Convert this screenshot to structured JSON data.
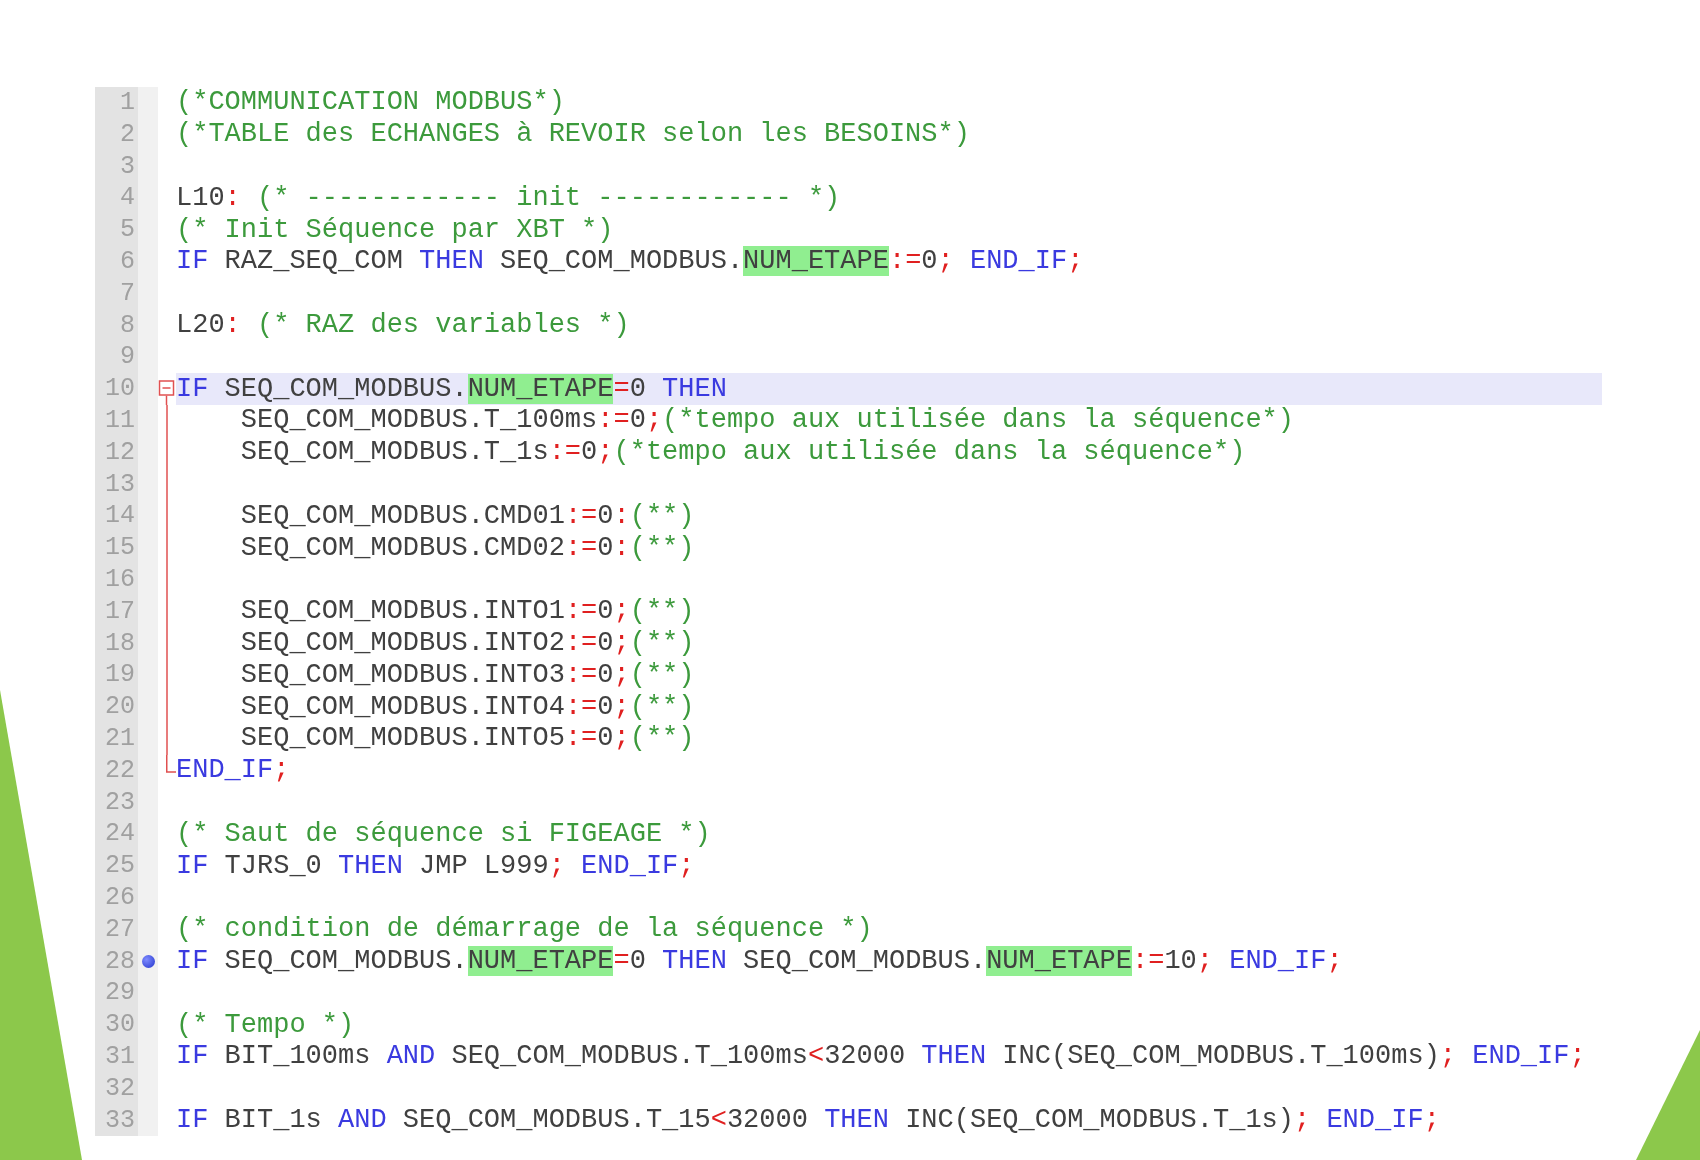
{
  "editor": {
    "lines": [
      {
        "number": "1",
        "current": false,
        "breakpoint": false,
        "collapsible": false,
        "in_fold": false,
        "tokens": [
          {
            "kind": "comment",
            "text": "(*COMMUNICATION MODBUS*)"
          }
        ]
      },
      {
        "number": "2",
        "current": false,
        "breakpoint": false,
        "collapsible": false,
        "in_fold": false,
        "tokens": [
          {
            "kind": "comment",
            "text": "(*TABLE des ECHANGES à REVOIR selon les BESOINS*)"
          }
        ]
      },
      {
        "number": "3",
        "current": false,
        "breakpoint": false,
        "collapsible": false,
        "in_fold": false
      },
      {
        "number": "4",
        "current": false,
        "breakpoint": false,
        "collapsible": false,
        "in_fold": false,
        "tokens": [
          {
            "kind": "plain",
            "text": "L10"
          },
          {
            "kind": "op",
            "text": ": "
          },
          {
            "kind": "comment",
            "text": "(* ------------ init ------------ *)"
          }
        ]
      },
      {
        "number": "5",
        "current": false,
        "breakpoint": false,
        "collapsible": false,
        "in_fold": false,
        "tokens": [
          {
            "kind": "comment",
            "text": "(* Init Séquence par XBT *)"
          }
        ]
      },
      {
        "number": "6",
        "current": false,
        "breakpoint": false,
        "collapsible": false,
        "in_fold": false,
        "tokens": [
          {
            "kind": "keyword",
            "text": "IF"
          },
          {
            "kind": "plain",
            "text": " RAZ_SEQ_COM "
          },
          {
            "kind": "keyword",
            "text": "THEN"
          },
          {
            "kind": "plain",
            "text": " SEQ_COM_MODBUS."
          },
          {
            "kind": "match",
            "text": "NUM_ETAPE"
          },
          {
            "kind": "op",
            "text": ":="
          },
          {
            "kind": "plain",
            "text": "0"
          },
          {
            "kind": "op",
            "text": "; "
          },
          {
            "kind": "keyword",
            "text": "END_IF"
          },
          {
            "kind": "op",
            "text": ";"
          }
        ]
      },
      {
        "number": "7",
        "current": false,
        "breakpoint": false,
        "collapsible": false,
        "in_fold": false
      },
      {
        "number": "8",
        "current": false,
        "breakpoint": false,
        "collapsible": false,
        "in_fold": false,
        "tokens": [
          {
            "kind": "plain",
            "text": "L20"
          },
          {
            "kind": "op",
            "text": ": "
          },
          {
            "kind": "comment",
            "text": "(* RAZ des variables *)"
          }
        ]
      },
      {
        "number": "9",
        "current": false,
        "breakpoint": false,
        "collapsible": false,
        "in_fold": false
      },
      {
        "number": "10",
        "current": true,
        "breakpoint": false,
        "collapsible": true,
        "in_fold": false,
        "tokens": [
          {
            "kind": "keyword",
            "text": "IF"
          },
          {
            "kind": "plain",
            "text": " SEQ_COM_MODBUS."
          },
          {
            "kind": "match",
            "text": "NUM_ETAPE"
          },
          {
            "kind": "op",
            "text": "="
          },
          {
            "kind": "plain",
            "text": "0 "
          },
          {
            "kind": "keyword",
            "text": "THEN"
          }
        ]
      },
      {
        "number": "11",
        "current": false,
        "breakpoint": false,
        "collapsible": false,
        "in_fold": true,
        "tokens": [
          {
            "kind": "plain",
            "text": "    SEQ_COM_MODBUS.T_100ms"
          },
          {
            "kind": "op",
            "text": ":="
          },
          {
            "kind": "plain",
            "text": "0"
          },
          {
            "kind": "op",
            "text": ";"
          },
          {
            "kind": "comment",
            "text": "(*tempo aux utilisée dans la séquence*)"
          }
        ]
      },
      {
        "number": "12",
        "current": false,
        "breakpoint": false,
        "collapsible": false,
        "in_fold": true,
        "tokens": [
          {
            "kind": "plain",
            "text": "    SEQ_COM_MODBUS.T_1s"
          },
          {
            "kind": "op",
            "text": ":="
          },
          {
            "kind": "plain",
            "text": "0"
          },
          {
            "kind": "op",
            "text": ";"
          },
          {
            "kind": "comment",
            "text": "(*tempo aux utilisée dans la séquence*)"
          }
        ]
      },
      {
        "number": "13",
        "current": false,
        "breakpoint": false,
        "collapsible": false,
        "in_fold": true
      },
      {
        "number": "14",
        "current": false,
        "breakpoint": false,
        "collapsible": false,
        "in_fold": true,
        "tokens": [
          {
            "kind": "plain",
            "text": "    SEQ_COM_MODBUS.CMD01"
          },
          {
            "kind": "op",
            "text": ":="
          },
          {
            "kind": "plain",
            "text": "0"
          },
          {
            "kind": "op",
            "text": ":"
          },
          {
            "kind": "comment",
            "text": "(**)"
          }
        ]
      },
      {
        "number": "15",
        "current": false,
        "breakpoint": false,
        "collapsible": false,
        "in_fold": true,
        "tokens": [
          {
            "kind": "plain",
            "text": "    SEQ_COM_MODBUS.CMD02"
          },
          {
            "kind": "op",
            "text": ":="
          },
          {
            "kind": "plain",
            "text": "0"
          },
          {
            "kind": "op",
            "text": ":"
          },
          {
            "kind": "comment",
            "text": "(**)"
          }
        ]
      },
      {
        "number": "16",
        "current": false,
        "breakpoint": false,
        "collapsible": false,
        "in_fold": true
      },
      {
        "number": "17",
        "current": false,
        "breakpoint": false,
        "collapsible": false,
        "in_fold": true,
        "tokens": [
          {
            "kind": "plain",
            "text": "    SEQ_COM_MODBUS.INTO1"
          },
          {
            "kind": "op",
            "text": ":="
          },
          {
            "kind": "plain",
            "text": "0"
          },
          {
            "kind": "op",
            "text": ";"
          },
          {
            "kind": "comment",
            "text": "(**)"
          }
        ]
      },
      {
        "number": "18",
        "current": false,
        "breakpoint": false,
        "collapsible": false,
        "in_fold": true,
        "tokens": [
          {
            "kind": "plain",
            "text": "    SEQ_COM_MODBUS.INTO2"
          },
          {
            "kind": "op",
            "text": ":="
          },
          {
            "kind": "plain",
            "text": "0"
          },
          {
            "kind": "op",
            "text": ";"
          },
          {
            "kind": "comment",
            "text": "(**)"
          }
        ]
      },
      {
        "number": "19",
        "current": false,
        "breakpoint": false,
        "collapsible": false,
        "in_fold": true,
        "tokens": [
          {
            "kind": "plain",
            "text": "    SEQ_COM_MODBUS.INTO3"
          },
          {
            "kind": "op",
            "text": ":="
          },
          {
            "kind": "plain",
            "text": "0"
          },
          {
            "kind": "op",
            "text": ";"
          },
          {
            "kind": "comment",
            "text": "(**)"
          }
        ]
      },
      {
        "number": "20",
        "current": false,
        "breakpoint": false,
        "collapsible": false,
        "in_fold": true,
        "tokens": [
          {
            "kind": "plain",
            "text": "    SEQ_COM_MODBUS.INTO4"
          },
          {
            "kind": "op",
            "text": ":="
          },
          {
            "kind": "plain",
            "text": "0"
          },
          {
            "kind": "op",
            "text": ";"
          },
          {
            "kind": "comment",
            "text": "(**)"
          }
        ]
      },
      {
        "number": "21",
        "current": false,
        "breakpoint": false,
        "collapsible": false,
        "in_fold": true,
        "tokens": [
          {
            "kind": "plain",
            "text": "    SEQ_COM_MODBUS.INTO5"
          },
          {
            "kind": "op",
            "text": ":="
          },
          {
            "kind": "plain",
            "text": "0"
          },
          {
            "kind": "op",
            "text": ";"
          },
          {
            "kind": "comment",
            "text": "(**)"
          }
        ]
      },
      {
        "number": "22",
        "current": false,
        "breakpoint": false,
        "collapsible": false,
        "in_fold": true,
        "tokens": [
          {
            "kind": "keyword",
            "text": "END_IF"
          },
          {
            "kind": "op",
            "text": ";"
          }
        ]
      },
      {
        "number": "23",
        "current": false,
        "breakpoint": false,
        "collapsible": false,
        "in_fold": false
      },
      {
        "number": "24",
        "current": false,
        "breakpoint": false,
        "collapsible": false,
        "in_fold": false,
        "tokens": [
          {
            "kind": "comment",
            "text": "(* Saut de séquence si FIGEAGE *)"
          }
        ]
      },
      {
        "number": "25",
        "current": false,
        "breakpoint": false,
        "collapsible": false,
        "in_fold": false,
        "tokens": [
          {
            "kind": "keyword",
            "text": "IF"
          },
          {
            "kind": "plain",
            "text": " TJRS_0 "
          },
          {
            "kind": "keyword",
            "text": "THEN"
          },
          {
            "kind": "plain",
            "text": " JMP L999"
          },
          {
            "kind": "op",
            "text": "; "
          },
          {
            "kind": "keyword",
            "text": "END_IF"
          },
          {
            "kind": "op",
            "text": ";"
          }
        ]
      },
      {
        "number": "26",
        "current": false,
        "breakpoint": false,
        "collapsible": false,
        "in_fold": false
      },
      {
        "number": "27",
        "current": false,
        "breakpoint": false,
        "collapsible": false,
        "in_fold": false,
        "tokens": [
          {
            "kind": "comment",
            "text": "(* condition de démarrage de la séquence *)"
          }
        ]
      },
      {
        "number": "28",
        "current": false,
        "breakpoint": true,
        "collapsible": false,
        "in_fold": false,
        "tokens": [
          {
            "kind": "keyword",
            "text": "IF"
          },
          {
            "kind": "plain",
            "text": " SEQ_COM_MODBUS."
          },
          {
            "kind": "match",
            "text": "NUM_ETAPE"
          },
          {
            "kind": "op",
            "text": "="
          },
          {
            "kind": "plain",
            "text": "0 "
          },
          {
            "kind": "keyword",
            "text": "THEN"
          },
          {
            "kind": "plain",
            "text": " SEQ_COM_MODBUS."
          },
          {
            "kind": "match",
            "text": "NUM_ETAPE"
          },
          {
            "kind": "op",
            "text": ":="
          },
          {
            "kind": "plain",
            "text": "10"
          },
          {
            "kind": "op",
            "text": "; "
          },
          {
            "kind": "keyword",
            "text": "END_IF"
          },
          {
            "kind": "op",
            "text": ";"
          }
        ]
      },
      {
        "number": "29",
        "current": false,
        "breakpoint": false,
        "collapsible": false,
        "in_fold": false
      },
      {
        "number": "30",
        "current": false,
        "breakpoint": false,
        "collapsible": false,
        "in_fold": false,
        "tokens": [
          {
            "kind": "comment",
            "text": "(* Tempo *)"
          }
        ]
      },
      {
        "number": "31",
        "current": false,
        "breakpoint": false,
        "collapsible": false,
        "in_fold": false,
        "tokens": [
          {
            "kind": "keyword",
            "text": "IF"
          },
          {
            "kind": "plain",
            "text": " BIT_100ms "
          },
          {
            "kind": "keyword",
            "text": "AND"
          },
          {
            "kind": "plain",
            "text": " SEQ_COM_MODBUS.T_100ms"
          },
          {
            "kind": "op",
            "text": "<"
          },
          {
            "kind": "plain",
            "text": "32000 "
          },
          {
            "kind": "keyword",
            "text": "THEN"
          },
          {
            "kind": "plain",
            "text": " INC(SEQ_COM_MODBUS.T_100ms)"
          },
          {
            "kind": "op",
            "text": "; "
          },
          {
            "kind": "keyword",
            "text": "END_IF"
          },
          {
            "kind": "op",
            "text": ";"
          }
        ]
      },
      {
        "number": "32",
        "current": false,
        "breakpoint": false,
        "collapsible": false,
        "in_fold": false
      },
      {
        "number": "33",
        "current": false,
        "breakpoint": false,
        "collapsible": false,
        "in_fold": false,
        "tokens": [
          {
            "kind": "keyword",
            "text": "IF"
          },
          {
            "kind": "plain",
            "text": " BIT_1s "
          },
          {
            "kind": "keyword",
            "text": "AND"
          },
          {
            "kind": "plain",
            "text": " SEQ_COM_MODBUS.T_15"
          },
          {
            "kind": "op",
            "text": "<"
          },
          {
            "kind": "plain",
            "text": "32000 "
          },
          {
            "kind": "keyword",
            "text": "THEN"
          },
          {
            "kind": "plain",
            "text": " INC(SEQ_COM_MODBUS.T_1s)"
          },
          {
            "kind": "op",
            "text": "; "
          },
          {
            "kind": "keyword",
            "text": "END_IF"
          },
          {
            "kind": "op",
            "text": ";"
          }
        ]
      }
    ]
  }
}
